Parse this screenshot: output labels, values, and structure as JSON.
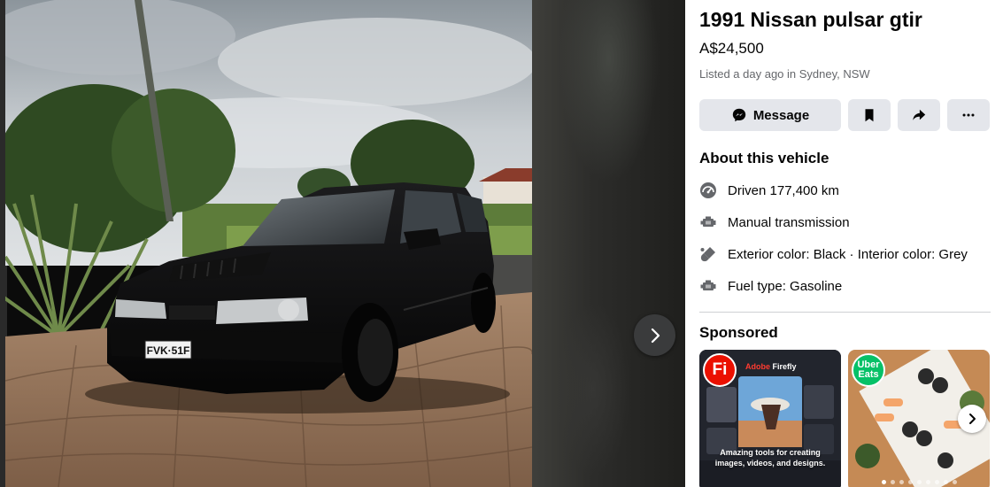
{
  "listing": {
    "title": "1991 Nissan pulsar gtir",
    "price": "A$24,500",
    "listed": "Listed a day ago in Sydney, NSW",
    "plate": "FVK·51F"
  },
  "actions": {
    "message_label": "Message"
  },
  "about": {
    "heading": "About this vehicle",
    "items": [
      {
        "icon": "odometer-icon",
        "text": "Driven 177,400 km"
      },
      {
        "icon": "engine-icon",
        "text": "Manual transmission"
      },
      {
        "icon": "paint-icon",
        "text": "Exterior color: Black · Interior color: Grey"
      },
      {
        "icon": "engine-icon",
        "text": "Fuel type: Gasoline"
      }
    ]
  },
  "sponsored": {
    "heading": "Sponsored",
    "ads": [
      {
        "logo": "Fi",
        "brand_prefix": "Adobe",
        "brand": "Firefly",
        "caption": "Amazing tools for creating images, videos, and designs."
      },
      {
        "logo": "Uber Eats"
      }
    ]
  },
  "colors": {
    "button_bg": "#e4e6eb",
    "text_primary": "#050505",
    "text_secondary": "#65676b",
    "firefly_red": "#eb1000",
    "uber_green": "#06c167"
  }
}
